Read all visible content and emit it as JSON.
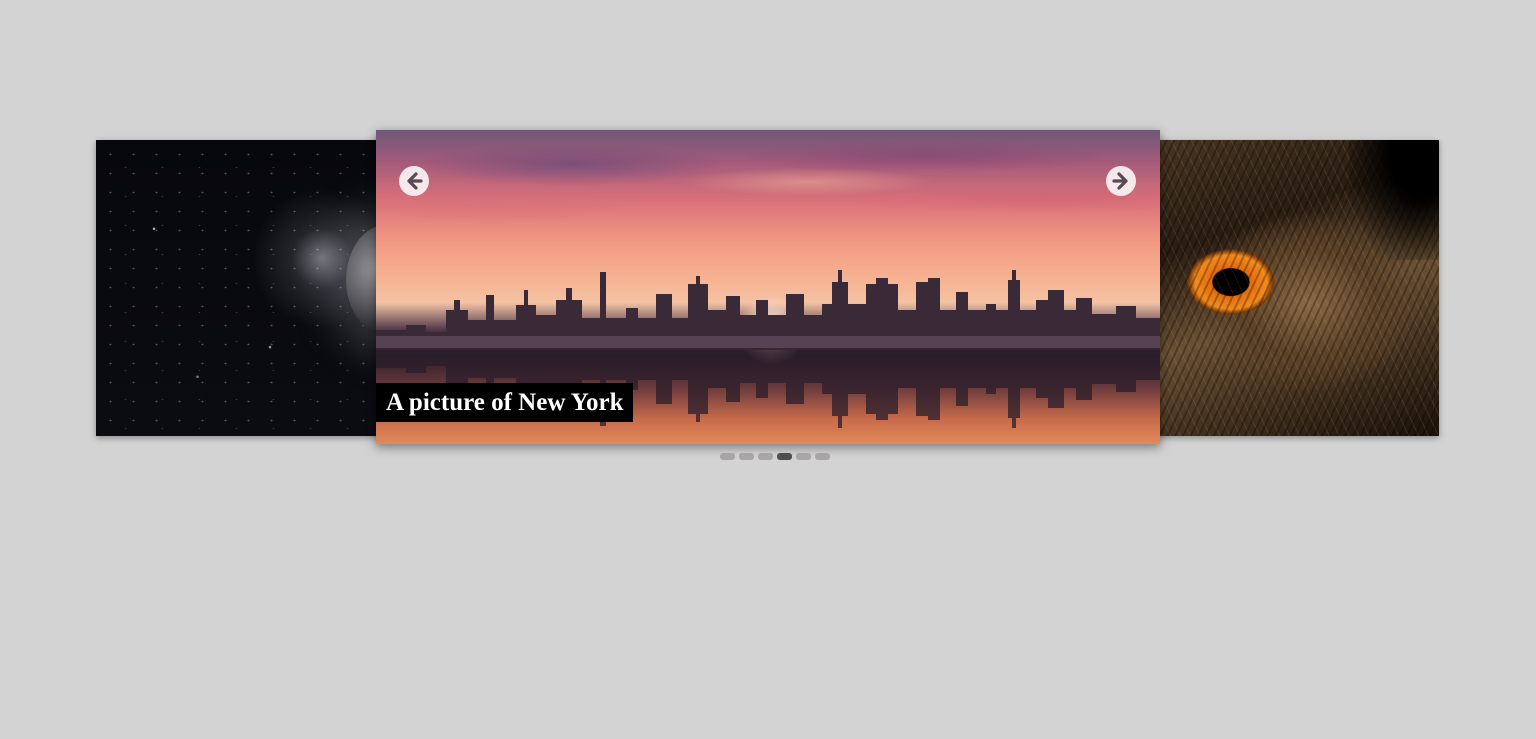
{
  "carousel": {
    "caption": "A picture of New York",
    "slide_left": {
      "subject": "moon in starry sky"
    },
    "slide_main": {
      "subject": "New York skyline at sunset with reflection"
    },
    "slide_right": {
      "subject": "owl eye close-up"
    },
    "prev_icon": "arrow-left-icon",
    "next_icon": "arrow-right-icon",
    "indicators": {
      "count": 6,
      "active_index": 3
    }
  },
  "colors": {
    "background": "#d3d3d3",
    "caption_bg": "#000000",
    "caption_text": "#ffffff",
    "indicator": "#a9a5a6",
    "indicator_active": "#4f4f4f"
  }
}
